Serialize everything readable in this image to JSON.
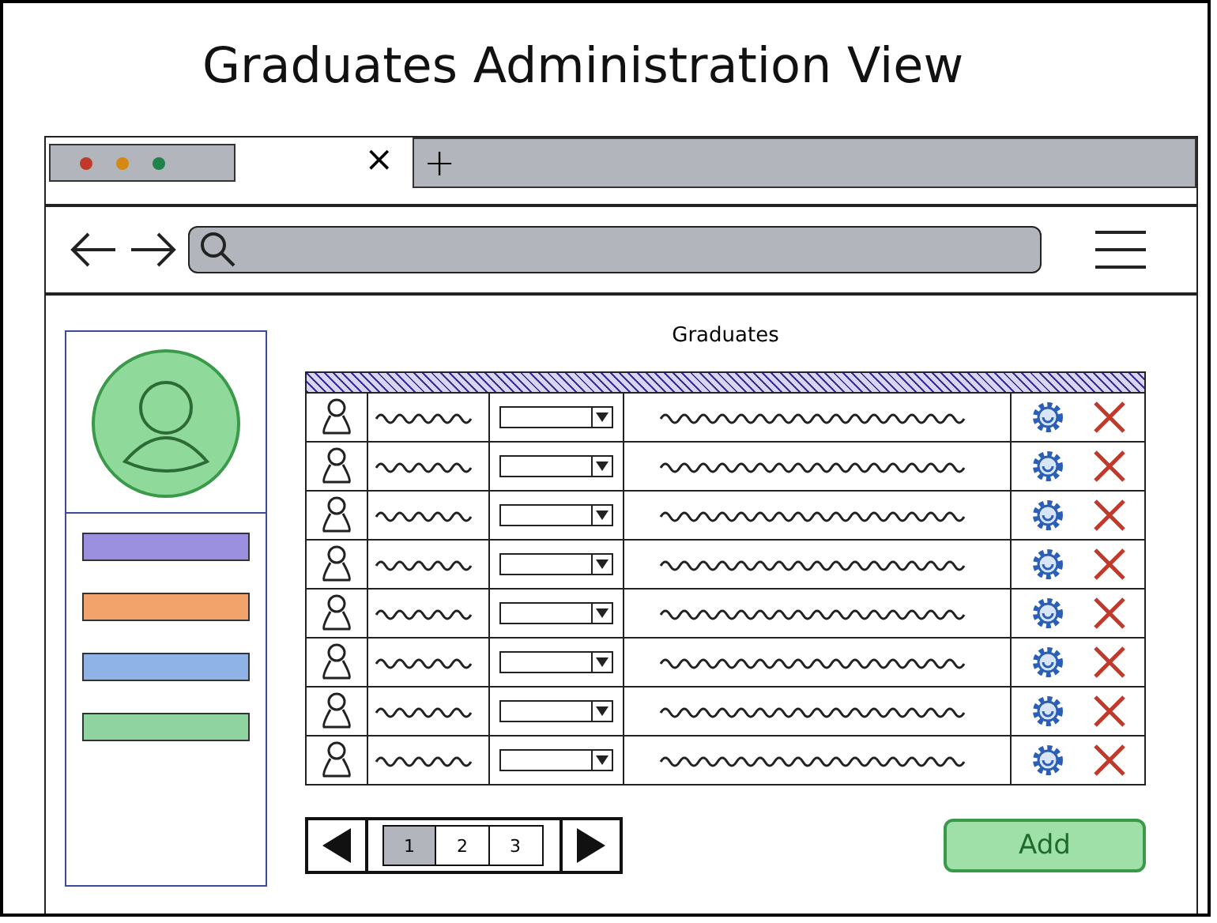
{
  "title": "Graduates Administration View",
  "browser": {
    "tab_close": "×",
    "new_tab": "+"
  },
  "sidebar": {
    "items": [
      {
        "color": "#9b8fe0"
      },
      {
        "color": "#f2a26b"
      },
      {
        "color": "#8fb3e6"
      },
      {
        "color": "#8fd4a0"
      }
    ]
  },
  "heading": "Graduates",
  "rows": [
    {
      "kind": "placeholder"
    },
    {
      "kind": "placeholder"
    },
    {
      "kind": "placeholder"
    },
    {
      "kind": "placeholder"
    },
    {
      "kind": "placeholder"
    },
    {
      "kind": "placeholder"
    },
    {
      "kind": "placeholder"
    },
    {
      "kind": "placeholder"
    }
  ],
  "pagination": {
    "pages": [
      {
        "label": "1",
        "selected": true
      },
      {
        "label": "2",
        "selected": false
      },
      {
        "label": "3",
        "selected": false
      }
    ]
  },
  "add_button": "Add"
}
